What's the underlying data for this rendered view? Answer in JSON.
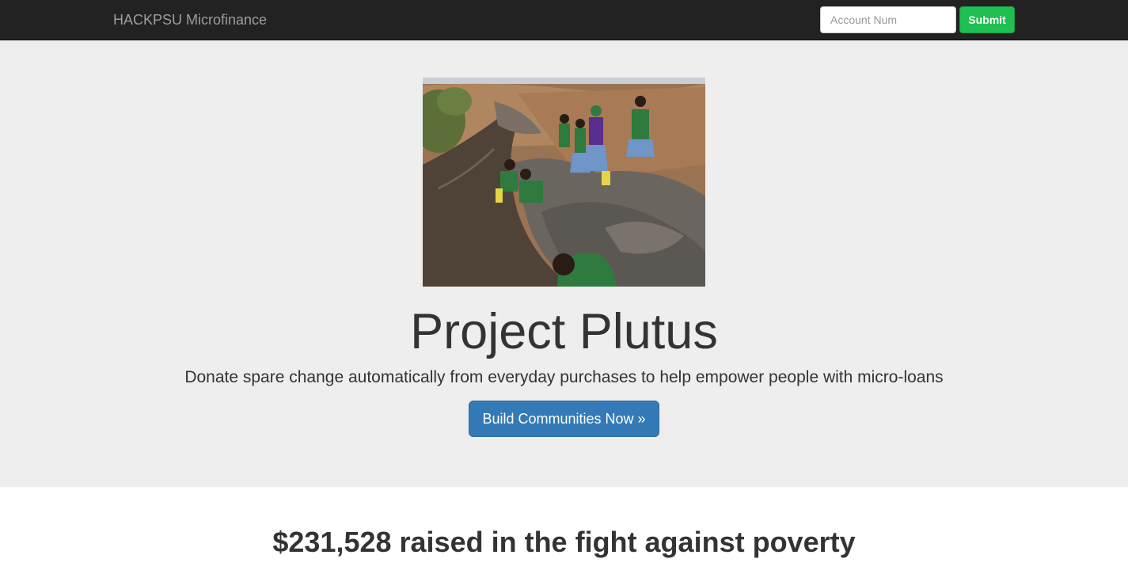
{
  "navbar": {
    "brand": "HACKPSU Microfinance",
    "account_placeholder": "Account Num",
    "submit_label": "Submit",
    "submit_color": "#1fbf52"
  },
  "hero": {
    "title": "Project Plutus",
    "subtitle": "Donate spare change automatically from everyday purchases to help empower people with micro-loans",
    "cta_label": "Build Communities Now »",
    "cta_color": "#337ab7"
  },
  "stats": {
    "raised_heading": "$231,528 raised in the fight against poverty"
  }
}
